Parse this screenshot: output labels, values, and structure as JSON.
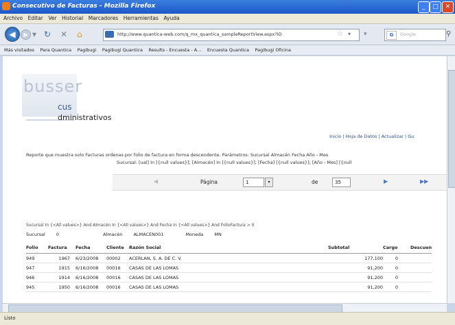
{
  "window": {
    "title": "Consecutivo de Facturas - Mozilla Firefox"
  },
  "menu": [
    "Archivo",
    "Editar",
    "Ver",
    "Historial",
    "Marcadores",
    "Herramientas",
    "Ayuda"
  ],
  "nav": {
    "url": "http://www.quantica-web.com/q_mx_quantica_sampleReportView.aspx?ID",
    "search_engine": "G",
    "search_placeholder": "Google"
  },
  "bookmarks": [
    "Más visitados",
    "Para Quantica",
    "Pagibugi",
    "Pagibugi Quantica",
    "Results - Encuesta - A...",
    "Encuesta Quantica",
    "Pagibugi Oficina"
  ],
  "page": {
    "logo": "busser",
    "brand_line1": "cus",
    "brand_line2": "dministrativos",
    "top_links": "Inicio | Hoja de Datos | Actualizar | Gu",
    "description": "Reporte que muestra solo Facturas ordenas por folio de factura en forma descendente. Parámetros: Sucursal Almacén Fecha Año - Mes",
    "description2": "Sucursal: [ual] In [{null values}]; [Almacén] In [{null values}]; [Fecha] [{null values}]; [Año - Mes] [{null",
    "pager": {
      "label": "Página",
      "current": "1",
      "of_label": "de",
      "total": "35"
    },
    "filter_text": "Sucursal In {<All values>} And Almacén In {<All values>} And Fecha In {<All values>} And FolioFactura > 0",
    "sucursal_label": "Sucursal",
    "sucursal_value": "0",
    "almacen_label": "Almacén",
    "almacen_value": "ALMACEN001",
    "moneda_label": "Moneda",
    "moneda_value": "MN",
    "table": {
      "headers": [
        "Folio",
        "Factura",
        "Fecha",
        "Cliente",
        "Razón Social",
        "Subtotal",
        "Cargo",
        "Descuen"
      ],
      "rows": [
        [
          "949",
          "1967",
          "6/23/2008",
          "00002",
          "ACERLAN, S. A. DE C. V.",
          "177,100",
          "0",
          ""
        ],
        [
          "947",
          "1915",
          "6/16/2008",
          "00016",
          "CASAS DE LAS LOMAS",
          "91,200",
          "0",
          ""
        ],
        [
          "946",
          "1914",
          "6/16/2008",
          "00016",
          "CASAS DE LAS LOMAS",
          "91,200",
          "0",
          ""
        ],
        [
          "945",
          "1950",
          "6/16/2008",
          "00016",
          "CASAS DE LAS LOMAS",
          "91,200",
          "0",
          ""
        ]
      ]
    }
  },
  "status": {
    "text": "Listo"
  },
  "colors": {
    "titlebar": "#1d57c8",
    "link": "#2a4d8f"
  }
}
